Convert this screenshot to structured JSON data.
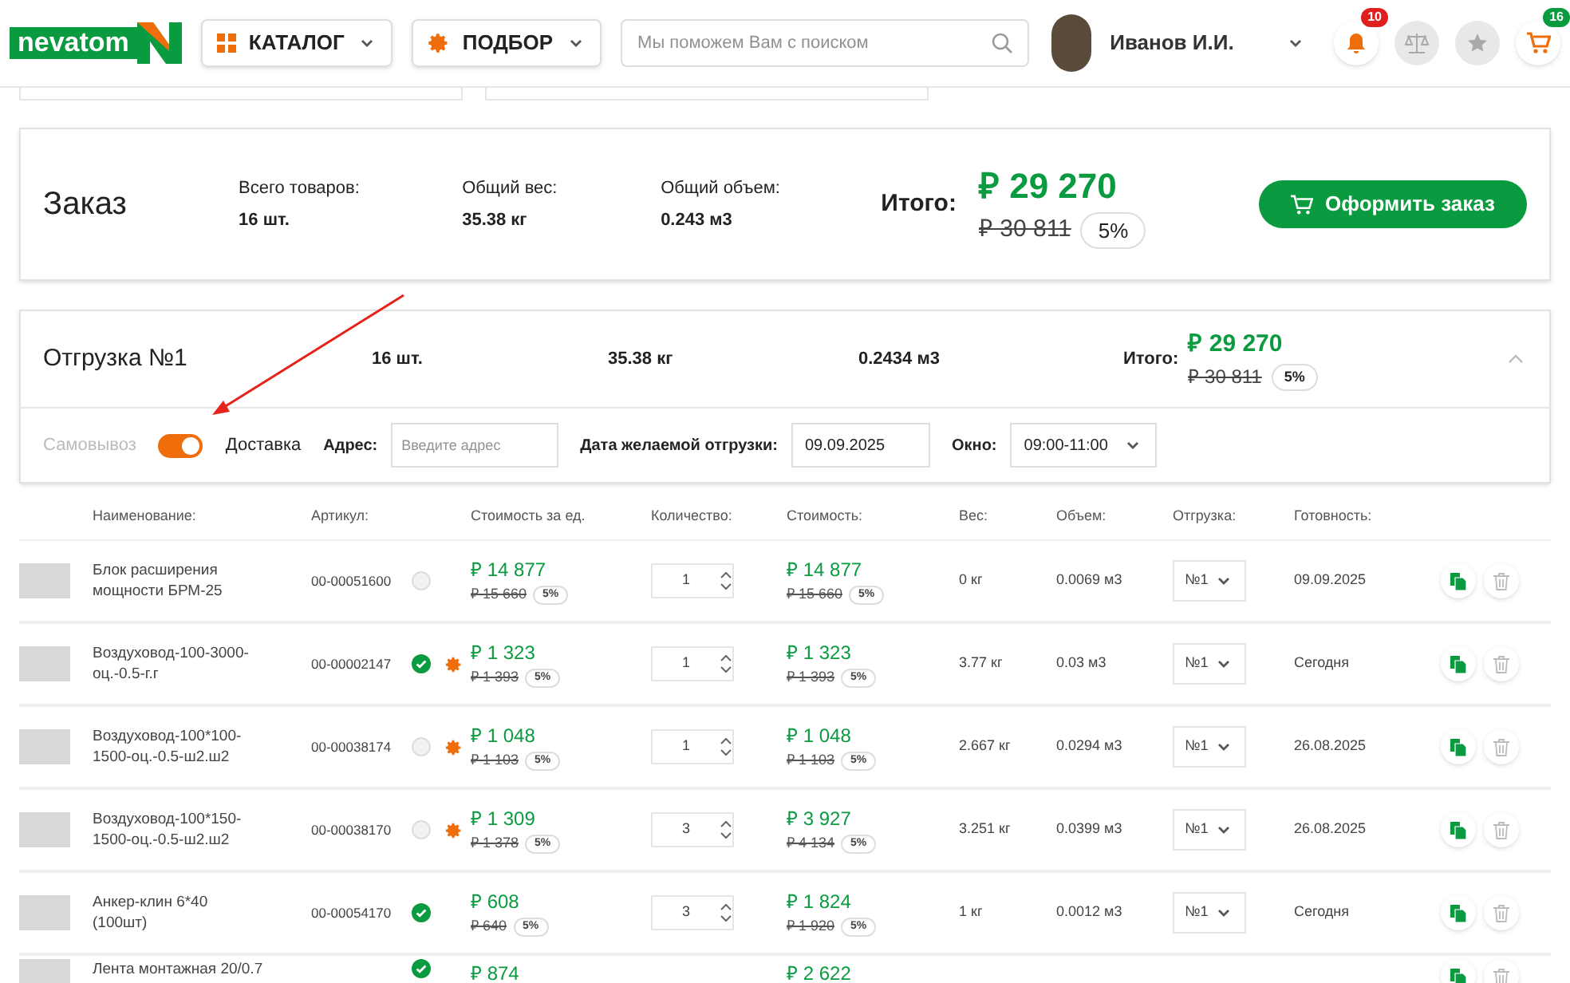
{
  "header": {
    "logo": "nevatom",
    "catalog_button": "КАТАЛОГ",
    "selection_button": "ПОДБОР",
    "search": {
      "placeholder": "Мы поможем Вам с поиском"
    },
    "user_name": "Иванов И.И.",
    "notifications_badge": "10",
    "cart_badge": "16"
  },
  "order": {
    "title": "Заказ",
    "stats": [
      {
        "label": "Всего товаров:",
        "value": "16 шт."
      },
      {
        "label": "Общий вес:",
        "value": "35.38 кг"
      },
      {
        "label": "Общий объем:",
        "value": "0.243 м3"
      }
    ],
    "total_label": "Итого:",
    "total": "₽ 29 270",
    "old_total": "₽ 30 811",
    "discount": "5%",
    "checkout_button": "Оформить заказ"
  },
  "shipment": {
    "title": "Отгрузка №1",
    "count": "16 шт.",
    "weight": "35.38 кг",
    "volume": "0.2434 м3",
    "total_label": "Итого:",
    "total": "₽ 29 270",
    "old_total": "₽ 30 811",
    "discount": "5%",
    "expanded": true,
    "pickup_label": "Самовывоз",
    "delivery_on": true,
    "delivery_label": "Доставка",
    "address_label": "Адрес:",
    "address": {
      "placeholder": "Введите адрес"
    },
    "date_label": "Дата желаемой отгрузки:",
    "date": "09.09.2025",
    "window_label": "Окно:",
    "window": "09:00-11:00"
  },
  "table": {
    "columns": [
      "Наименование:",
      "Артикул:",
      "Стоимость за ед.",
      "Количество:",
      "Стоимость:",
      "Вес:",
      "Объем:",
      "Отгрузка:",
      "Готовность:"
    ],
    "rows": [
      {
        "name": "Блок расширения мощности БРМ-25",
        "article": "00-00051600",
        "available": false,
        "configurable": false,
        "price": "₽ 14 877",
        "old_price": "₽ 15 660",
        "discount": "5%",
        "quantity": "1",
        "cost": "₽ 14 877",
        "old_cost": "₽ 15 660",
        "cost_discount": "5%",
        "weight": "0 кг",
        "volume": "0.0069 м3",
        "shipment": "№1",
        "readiness": "09.09.2025"
      },
      {
        "name": "Воздуховод-100-3000-оц.-0.5-г.г",
        "article": "00-00002147",
        "available": true,
        "configurable": true,
        "price": "₽ 1 323",
        "old_price": "₽ 1 393",
        "discount": "5%",
        "quantity": "1",
        "cost": "₽ 1 323",
        "old_cost": "₽ 1 393",
        "cost_discount": "5%",
        "weight": "3.77 кг",
        "volume": "0.03 м3",
        "shipment": "№1",
        "readiness": "Сегодня"
      },
      {
        "name": "Воздуховод-100*100-1500-оц.-0.5-ш2.ш2",
        "article": "00-00038174",
        "available": false,
        "configurable": true,
        "price": "₽ 1 048",
        "old_price": "₽ 1 103",
        "discount": "5%",
        "quantity": "1",
        "cost": "₽ 1 048",
        "old_cost": "₽ 1 103",
        "cost_discount": "5%",
        "weight": "2.667 кг",
        "volume": "0.0294 м3",
        "shipment": "№1",
        "readiness": "26.08.2025"
      },
      {
        "name": "Воздуховод-100*150-1500-оц.-0.5-ш2.ш2",
        "article": "00-00038170",
        "available": false,
        "configurable": true,
        "price": "₽ 1 309",
        "old_price": "₽ 1 378",
        "discount": "5%",
        "quantity": "3",
        "cost": "₽ 3 927",
        "old_cost": "₽ 4 134",
        "cost_discount": "5%",
        "weight": "3.251 кг",
        "volume": "0.0399 м3",
        "shipment": "№1",
        "readiness": "26.08.2025"
      },
      {
        "name": "Анкер-клин 6*40 (100шт)",
        "article": "00-00054170",
        "available": true,
        "configurable": false,
        "price": "₽ 608",
        "old_price": "₽ 640",
        "discount": "5%",
        "quantity": "3",
        "cost": "₽ 1 824",
        "old_cost": "₽ 1 920",
        "cost_discount": "5%",
        "weight": "1 кг",
        "volume": "0.0012 м3",
        "shipment": "№1",
        "readiness": "Сегодня"
      },
      {
        "name": "Лента монтажная 20/0.7",
        "available": true,
        "configurable": false,
        "price": "₽ 874",
        "cost": "₽ 2 622"
      }
    ]
  }
}
